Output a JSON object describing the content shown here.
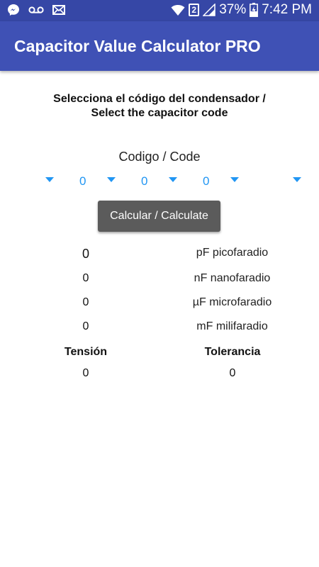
{
  "status_bar": {
    "left_icons": [
      "messenger-icon",
      "voicemail-icon",
      "mail-icon"
    ],
    "right_icons": [
      "wifi-icon",
      "sim-2-icon",
      "signal-icon",
      "battery-charging-icon"
    ],
    "sim": "2",
    "battery": "37%",
    "time": "7:42 PM",
    "background": "#3647a6"
  },
  "app_bar": {
    "title": "Capacitor Value Calculator PRO",
    "color": "#3f51b5"
  },
  "instruction": {
    "line1": "Selecciona el código del condensador /",
    "line2": "Select the capacitor code"
  },
  "code_label": "Codigo / Code",
  "spinners": [
    "",
    "0",
    "0",
    "0",
    ""
  ],
  "accent_color": "#2196f3",
  "calculate_button": "Calcular / Calculate",
  "results": {
    "pf": {
      "value": "0",
      "unit": "pF picofaradio"
    },
    "nf": {
      "value": "0",
      "unit": "nF nanofaradio"
    },
    "uf": {
      "value": "0",
      "unit": "µF microfaradio"
    },
    "mf": {
      "value": "0",
      "unit": "mF milifaradio"
    }
  },
  "extra": {
    "tension_label": "Tensión",
    "tension_value": "0",
    "tolerance_label": "Tolerancia",
    "tolerance_value": "0"
  }
}
